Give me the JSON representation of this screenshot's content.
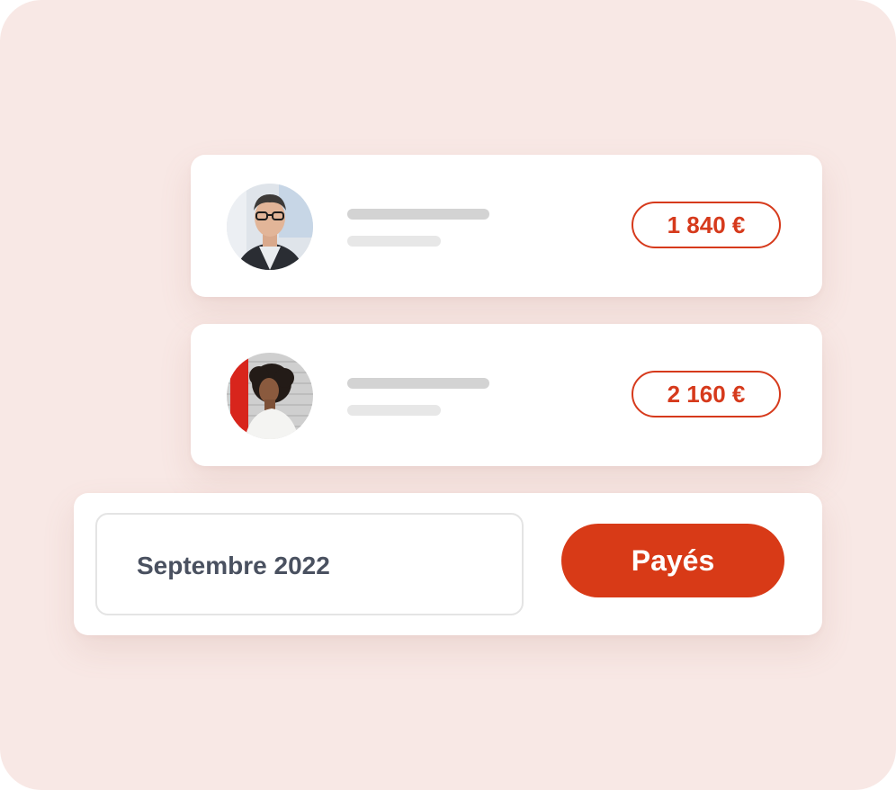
{
  "payments": [
    {
      "amount": "1 840 €",
      "avatar": "man-with-glasses-avatar"
    },
    {
      "amount": "2 160 €",
      "avatar": "woman-curly-hair-avatar"
    }
  ],
  "filter": {
    "date_value": "Septembre 2022",
    "paid_button_label": "Payés"
  },
  "colors": {
    "background": "#f8e8e5",
    "accent": "#d83a17",
    "amount_text": "#d63a1c",
    "date_text": "#4a5160"
  }
}
